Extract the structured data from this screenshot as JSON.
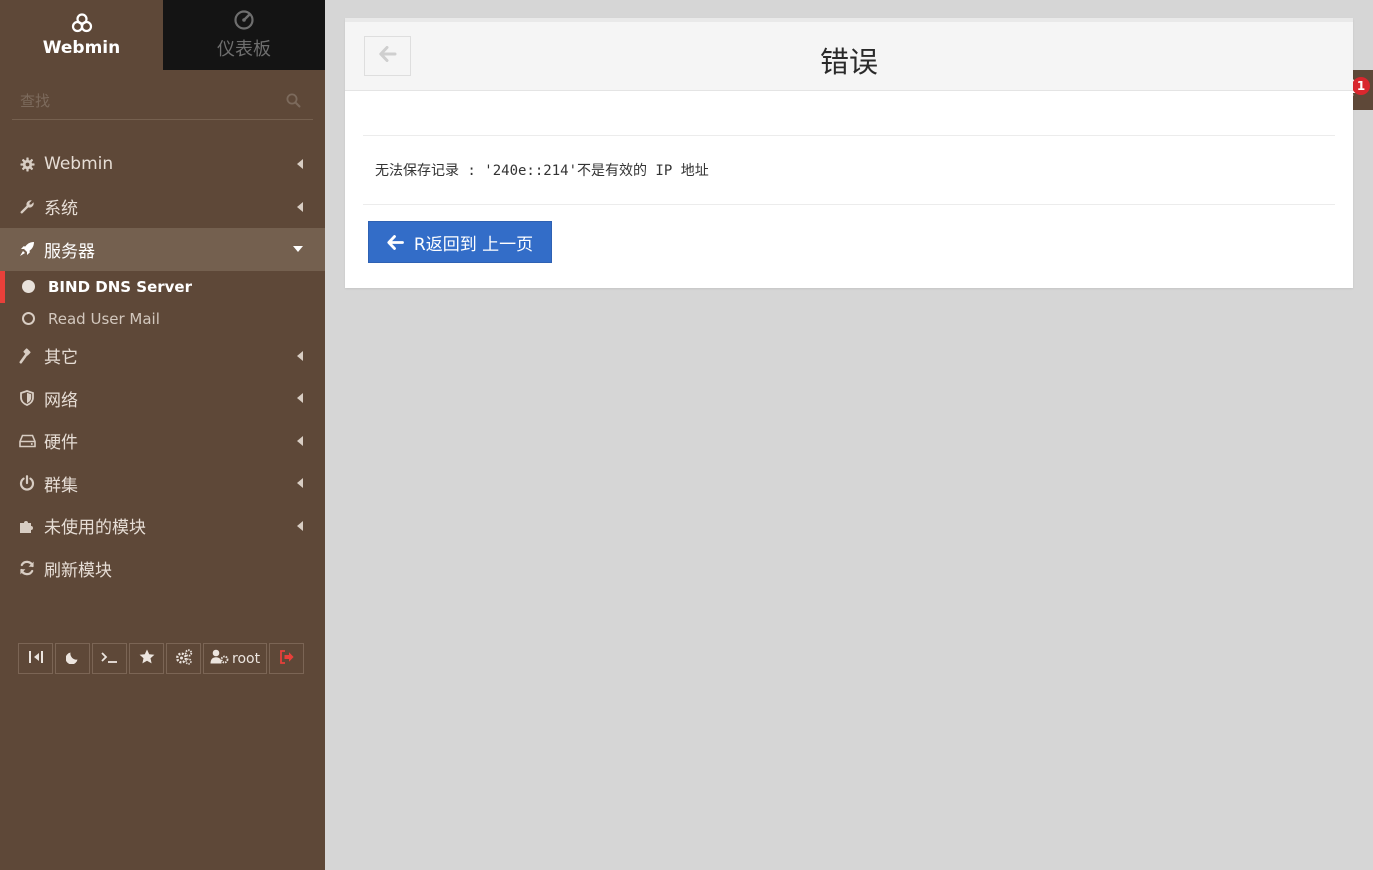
{
  "sidebar": {
    "tabs": [
      {
        "label": "Webmin",
        "icon": "webmin-logo-icon"
      },
      {
        "label": "仪表板",
        "icon": "dashboard-icon"
      }
    ],
    "search": {
      "placeholder": "查找"
    },
    "menu": [
      {
        "label": "Webmin",
        "icon": "gear-icon"
      },
      {
        "label": "系统",
        "icon": "wrench-icon"
      },
      {
        "label": "服务器",
        "icon": "rocket-icon"
      },
      {
        "label": "其它",
        "icon": "gavel-icon"
      },
      {
        "label": "网络",
        "icon": "shield-icon"
      },
      {
        "label": "硬件",
        "icon": "hdd-icon"
      },
      {
        "label": "群集",
        "icon": "power-icon"
      },
      {
        "label": "未使用的模块",
        "icon": "puzzle-icon"
      },
      {
        "label": "刷新模块",
        "icon": "refresh-icon"
      }
    ],
    "submenu": [
      {
        "label": "BIND DNS Server"
      },
      {
        "label": "Read User Mail"
      }
    ],
    "toolbar": {
      "user_label": "root"
    }
  },
  "notifications": {
    "count": "1"
  },
  "main": {
    "title": "错误",
    "error_message": "无法保存记录 : '240e::214'不是有效的 IP 地址",
    "return_button": "R返回到 上一页"
  },
  "colors": {
    "sidebar_bg": "#5e4838",
    "accent_red": "#e8403a",
    "button_blue": "#336dc8"
  }
}
